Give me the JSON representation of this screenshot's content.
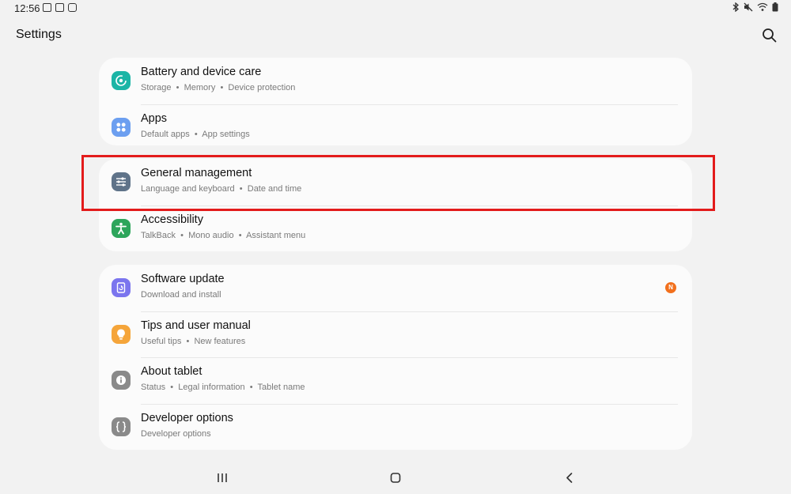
{
  "status_bar": {
    "time": "12:56",
    "notification_icons": [
      "gallery-icon",
      "news-icon",
      "screen-recorder-icon"
    ],
    "system_icons": [
      "bluetooth-icon",
      "mute-icon",
      "wifi-icon",
      "battery-icon"
    ]
  },
  "header": {
    "title": "Settings",
    "search_icon": "search-icon"
  },
  "groups": [
    {
      "items": [
        {
          "title": "Battery and device care",
          "subtitle": [
            "Storage",
            "Memory",
            "Device protection"
          ],
          "icon": "battery-care-icon",
          "icon_color": "#1bb5a6"
        },
        {
          "title": "Apps",
          "subtitle": [
            "Default apps",
            "App settings"
          ],
          "icon": "apps-icon",
          "icon_color": "#6c9ff0"
        }
      ]
    },
    {
      "items": [
        {
          "title": "General management",
          "subtitle": [
            "Language and keyboard",
            "Date and time"
          ],
          "icon": "sliders-icon",
          "icon_color": "#5f7389"
        },
        {
          "title": "Accessibility",
          "subtitle": [
            "TalkBack",
            "Mono audio",
            "Assistant menu"
          ],
          "icon": "accessibility-icon",
          "icon_color": "#2da55b"
        }
      ]
    },
    {
      "items": [
        {
          "title": "Software update",
          "subtitle": [
            "Download and install"
          ],
          "icon": "software-update-icon",
          "icon_color": "#7b75ee",
          "badge": "N"
        },
        {
          "title": "Tips and user manual",
          "subtitle": [
            "Useful tips",
            "New features"
          ],
          "icon": "lightbulb-icon",
          "icon_color": "#f5a53a"
        },
        {
          "title": "About tablet",
          "subtitle": [
            "Status",
            "Legal information",
            "Tablet name"
          ],
          "icon": "info-icon",
          "icon_color": "#8a8a8a"
        },
        {
          "title": "Developer options",
          "subtitle": [
            "Developer options"
          ],
          "icon": "braces-icon",
          "icon_color": "#8a8a8a"
        }
      ]
    }
  ],
  "highlight": {
    "target": "General management",
    "color": "#e31b1b"
  },
  "nav_bar": {
    "buttons": [
      "recents-icon",
      "home-icon",
      "back-icon"
    ]
  }
}
